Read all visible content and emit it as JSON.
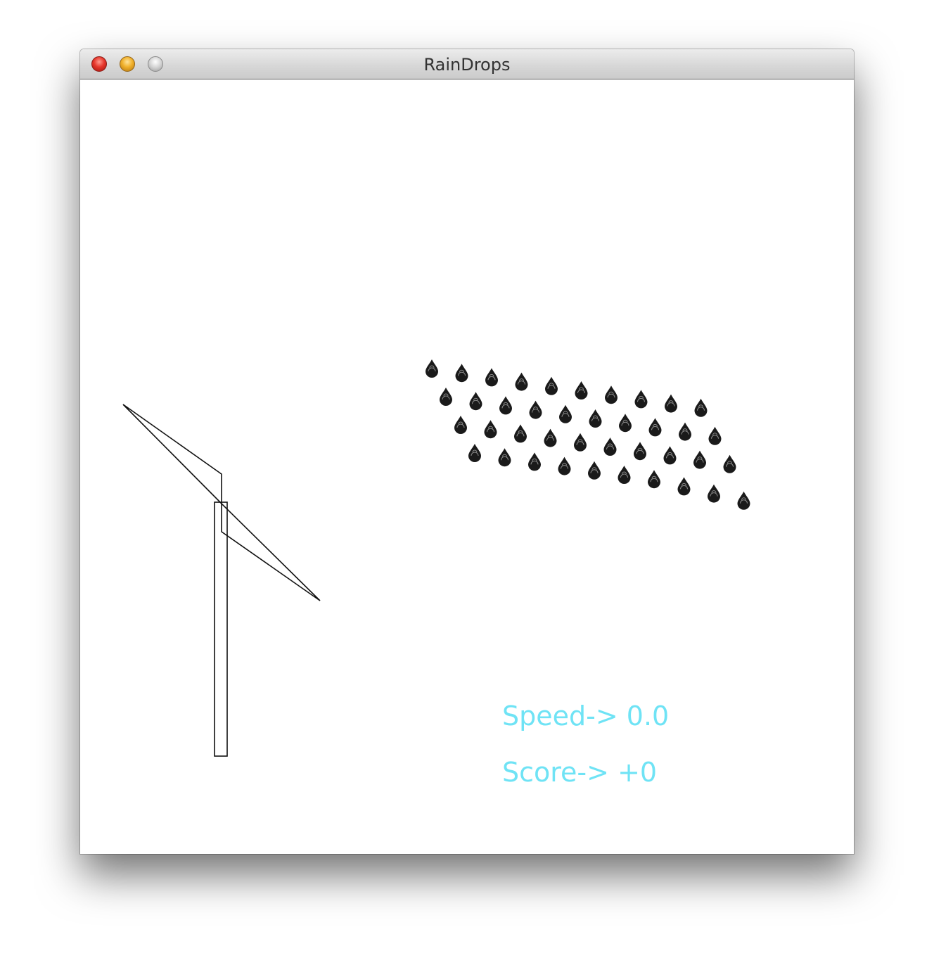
{
  "window": {
    "title": "RainDrops"
  },
  "hud": {
    "speed_label": "Speed->",
    "speed_value": "0.0",
    "score_label": "Score->",
    "score_value": "+0",
    "text_color": "#6fe3f5"
  },
  "drops": {
    "rows": 4,
    "columns": 10,
    "color": "#1a1a1a"
  },
  "scene": {
    "windmill_color": "#111111"
  }
}
